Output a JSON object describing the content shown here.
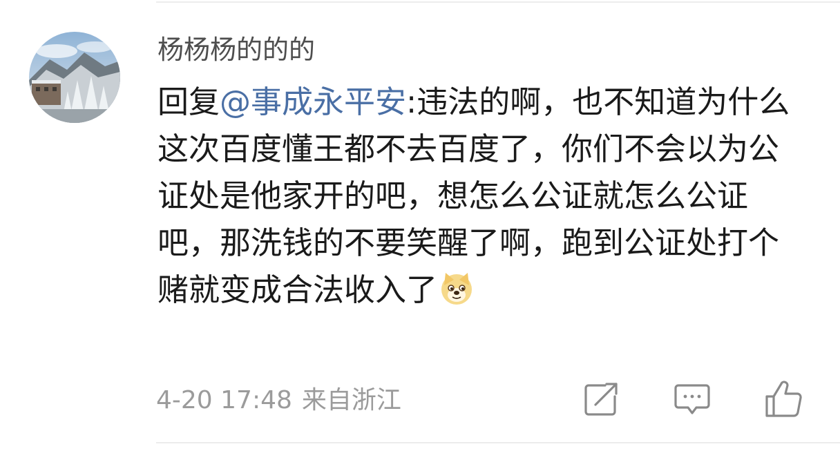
{
  "comment": {
    "username": "杨杨杨的的的",
    "reply_prefix": "回复",
    "mention": "@事成永平安",
    "text": ":违法的啊，也不知道为什么这次百度懂王都不去百度了，你们不会以为公证处是他家开的吧，想怎么公证就怎么公证吧，那洗钱的不要笑醒了啊，跑到公证处打个赌就变成合法收入了",
    "emoji": "doge-emoji",
    "timestamp": "4-20 17:48",
    "location": "来自浙江"
  },
  "actions": {
    "share_icon": "share-icon",
    "reply_icon": "comment-icon",
    "like_icon": "thumbs-up-icon"
  },
  "colors": {
    "mention": "#4a6fa5",
    "text": "#1a1a1a",
    "username": "#4e4e4e",
    "meta": "#9b9b9b",
    "icon": "#8a8a8a"
  }
}
